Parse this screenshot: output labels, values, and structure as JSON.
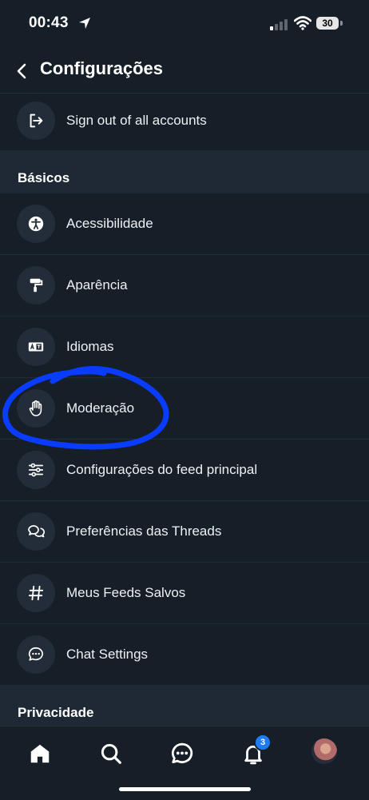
{
  "status_bar": {
    "time": "00:43",
    "battery": "30"
  },
  "header": {
    "title": "Configurações",
    "back_icon": "chevron-left-icon"
  },
  "account_row": {
    "label": "Sign out of all accounts",
    "icon": "sign-out-icon"
  },
  "sections": [
    {
      "title": "Básicos",
      "items": [
        {
          "label": "Acessibilidade",
          "icon": "accessibility-icon"
        },
        {
          "label": "Aparência",
          "icon": "paint-roller-icon"
        },
        {
          "label": "Idiomas",
          "icon": "language-icon"
        },
        {
          "label": "Moderação",
          "icon": "hand-icon"
        },
        {
          "label": "Configurações do feed principal",
          "icon": "sliders-icon"
        },
        {
          "label": "Preferências das Threads",
          "icon": "chat-bubbles-icon"
        },
        {
          "label": "Meus Feeds Salvos",
          "icon": "hashtag-icon"
        },
        {
          "label": "Chat Settings",
          "icon": "chat-dots-icon"
        }
      ]
    },
    {
      "title": "Privacidade",
      "items": []
    }
  ],
  "tab_bar": {
    "tabs": [
      "home-icon",
      "search-icon",
      "messages-icon",
      "notifications-icon",
      "profile-avatar"
    ],
    "notification_count": "3"
  },
  "colors": {
    "background": "#161e27",
    "section_background": "#1e2935",
    "icon_circle": "#232d39",
    "accent": "#1d7cf2",
    "annotation": "#0a3cff"
  }
}
